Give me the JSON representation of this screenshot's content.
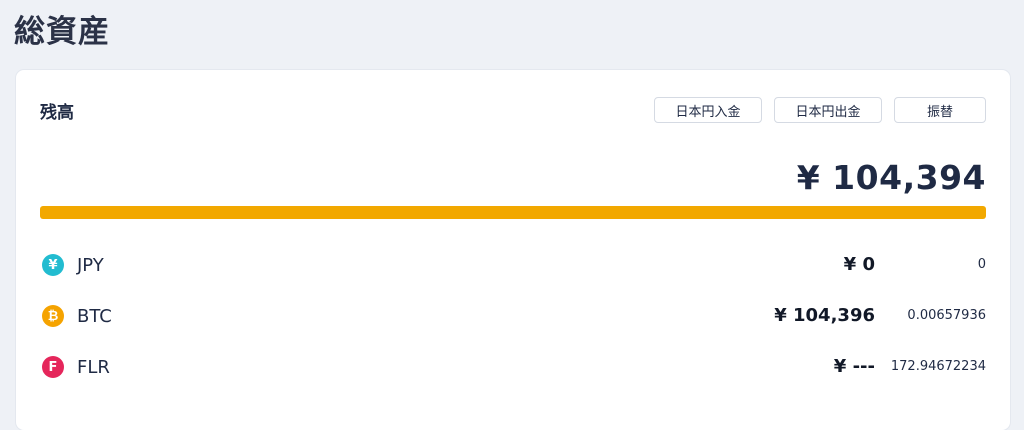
{
  "page": {
    "title": "総資産"
  },
  "balance_card": {
    "title": "残高",
    "buttons": {
      "deposit_jpy": "日本円入金",
      "withdraw_jpy": "日本円出金",
      "transfer": "振替"
    },
    "total": "¥ 104,394",
    "bar_color": "#f2a800"
  },
  "assets": [
    {
      "name": "JPY",
      "icon": "yen-icon",
      "icon_glyph": "¥",
      "icon_color": "#22bcd0",
      "value": "¥ 0",
      "amount": "0"
    },
    {
      "name": "BTC",
      "icon": "bitcoin-icon",
      "icon_glyph": "₿",
      "icon_color": "#f5a300",
      "value": "¥ 104,396",
      "amount": "0.00657936"
    },
    {
      "name": "FLR",
      "icon": "flare-icon",
      "icon_glyph": "F",
      "icon_color": "#e5265b",
      "value": "¥ ---",
      "amount": "172.94672234"
    }
  ]
}
